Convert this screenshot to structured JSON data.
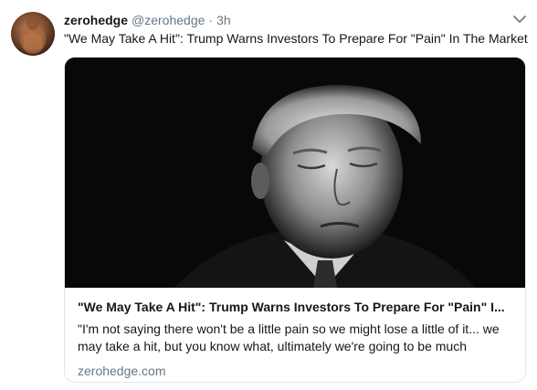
{
  "tweet": {
    "author_name": "zerohedge",
    "author_handle": "@zerohedge",
    "separator": "·",
    "timestamp": "3h",
    "text": "\"We May Take A Hit\": Trump Warns Investors To Prepare For \"Pain\" In The Market",
    "caret_icon": "chevron-down-icon",
    "avatar_icon": "avatar"
  },
  "card": {
    "image_icon": "portrait-photo",
    "title": "\"We May Take A Hit\": Trump Warns Investors To Prepare For \"Pain\" I...",
    "description": "\"I'm not saying there won't be a little pain so we might lose a little of it... we may take a hit, but you know what, ultimately we're going to be much",
    "domain": "zerohedge.com"
  },
  "colors": {
    "text_primary": "#14171a",
    "text_secondary": "#657786",
    "border": "#e1e8ed",
    "background": "#ffffff"
  }
}
